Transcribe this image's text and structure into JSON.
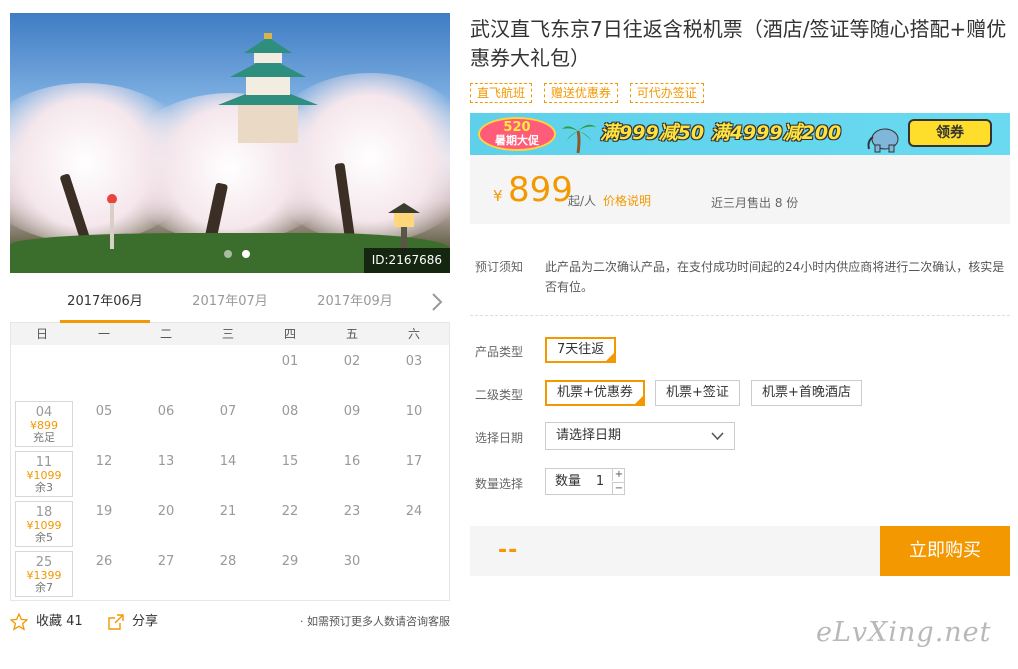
{
  "gallery": {
    "image_id": "ID:2167686",
    "slides": 2,
    "active_slide": 2,
    "image_subject": "castle-with-cherry-blossoms"
  },
  "calendar": {
    "months": [
      "2017年06月",
      "2017年07月",
      "2017年09月"
    ],
    "active_month": 0,
    "weekdays": [
      "日",
      "一",
      "二",
      "三",
      "四",
      "五",
      "六"
    ],
    "weeks": [
      [
        null,
        null,
        null,
        null,
        {
          "day": "01"
        },
        {
          "day": "02"
        },
        {
          "day": "03"
        }
      ],
      [
        {
          "day": "04",
          "price": "¥899",
          "stock": "充足"
        },
        {
          "day": "05"
        },
        {
          "day": "06"
        },
        {
          "day": "07"
        },
        {
          "day": "08"
        },
        {
          "day": "09"
        },
        {
          "day": "10"
        }
      ],
      [
        {
          "day": "11",
          "price": "¥1099",
          "stock": "余3"
        },
        {
          "day": "12"
        },
        {
          "day": "13"
        },
        {
          "day": "14"
        },
        {
          "day": "15"
        },
        {
          "day": "16"
        },
        {
          "day": "17"
        }
      ],
      [
        {
          "day": "18",
          "price": "¥1099",
          "stock": "余5"
        },
        {
          "day": "19"
        },
        {
          "day": "20"
        },
        {
          "day": "21"
        },
        {
          "day": "22"
        },
        {
          "day": "23"
        },
        {
          "day": "24"
        }
      ],
      [
        {
          "day": "25",
          "price": "¥1399",
          "stock": "余7"
        },
        {
          "day": "26"
        },
        {
          "day": "27"
        },
        {
          "day": "28"
        },
        {
          "day": "29"
        },
        {
          "day": "30"
        },
        null
      ]
    ]
  },
  "actions": {
    "favorite_label": "收藏",
    "favorite_count": "41",
    "share_label": "分享",
    "consult_text": "· 如需预订更多人数请咨询客服"
  },
  "product": {
    "title": "武汉直飞东京7日往返含税机票（酒店/签证等随心搭配+赠优惠券大礼包）",
    "tags": [
      "直飞航班",
      "赠送优惠券",
      "可代办签证"
    ]
  },
  "banner": {
    "badge_top": "520",
    "badge_bottom": "暑期大促",
    "deal_text": "满999减50 满4999减200",
    "claim_label": "领券",
    "colors": {
      "background": "#64d6ee",
      "deal": "#ffe23d",
      "badge": "#ff5c7a",
      "claim": "#ffde2b"
    }
  },
  "price": {
    "currency": "¥",
    "amount": "899",
    "unit": "起/人",
    "explain_label": "价格说明",
    "sold_text": "近三月售出 8 份"
  },
  "notice": {
    "label": "预订须知",
    "text": "此产品为二次确认产品，在支付成功时间起的24小时内供应商将进行二次确认，核实是否有位。"
  },
  "options": {
    "product_type_label": "产品类型",
    "product_types": [
      "7天往返"
    ],
    "secondary_type_label": "二级类型",
    "secondary_types": [
      "机票+优惠券",
      "机票+签证",
      "机票+首晚酒店"
    ],
    "selected_secondary": 0,
    "date_label": "选择日期",
    "date_placeholder": "请选择日期",
    "qty_section_label": "数量选择",
    "qty_label": "数量",
    "qty_value": "1",
    "qty_plus": "+",
    "qty_minus": "−"
  },
  "buy": {
    "total": "--",
    "button_label": "立即购买"
  },
  "watermark": "eLvXing.net",
  "colors": {
    "accent": "#f39800",
    "panel": "#f5f5f5"
  }
}
